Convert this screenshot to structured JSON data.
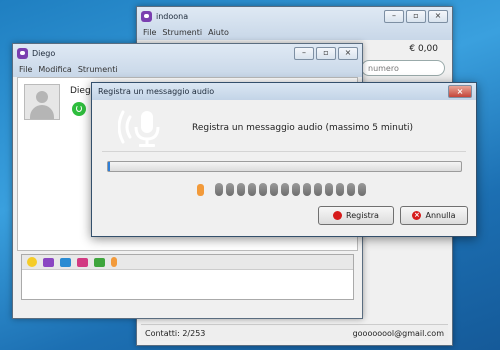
{
  "main_window": {
    "title": "indoona",
    "menu": [
      "File",
      "Strumenti",
      "Aiuto"
    ],
    "credit": "€ 0,00",
    "search_placeholder": "numero",
    "status_left": "Contatti: 2/253",
    "status_right": "goooooool@gmail.com"
  },
  "chat_window": {
    "title": "Diego",
    "menu": [
      "File",
      "Modifica",
      "Strumenti"
    ],
    "contact_name": "Diego",
    "toolbar_icons": [
      "emoji-icon",
      "folder-icon",
      "camera-icon",
      "video-icon",
      "sms-icon",
      "microphone-icon"
    ]
  },
  "dialog": {
    "title": "Registra un messaggio audio",
    "message": "Registra un messaggio audio (massimo 5 minuti)",
    "progress": 0.0,
    "level_bars": 14,
    "record_label": "Registra",
    "cancel_label": "Annulla"
  },
  "colors": {
    "desktop": "#1f7fc1",
    "accent_purple": "#7a3fb0",
    "record_red": "#d61b1b",
    "mic_orange": "#f29a3a"
  }
}
